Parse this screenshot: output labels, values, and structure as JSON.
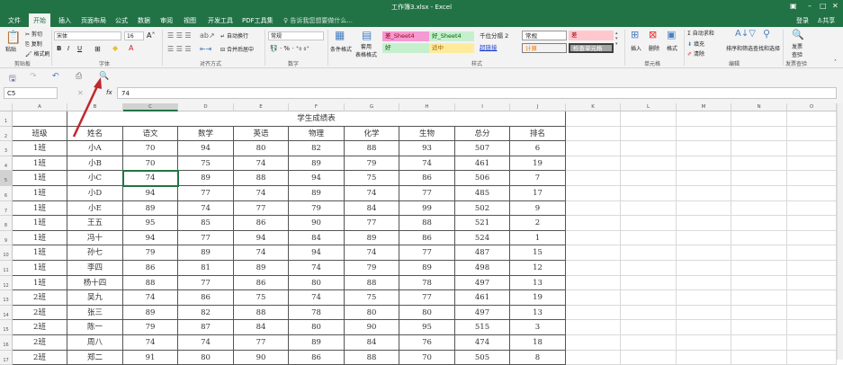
{
  "window": {
    "title": "工作簿3.xlsx - Excel",
    "login": "登录",
    "share": "共享"
  },
  "tabs": [
    "文件",
    "开始",
    "插入",
    "页面布局",
    "公式",
    "数据",
    "审阅",
    "视图",
    "开发工具",
    "PDF工具集"
  ],
  "tell_me": "告诉我您想要做什么...",
  "ribbon": {
    "clipboard": {
      "paste": "粘贴",
      "cut": "剪切",
      "copy": "复制",
      "format_painter": "格式刷",
      "group": "剪贴板"
    },
    "font": {
      "name": "宋体",
      "size": "16",
      "group": "字体",
      "bold": "B",
      "italic": "I",
      "underline": "U"
    },
    "alignment": {
      "wrap": "自动换行",
      "merge": "合并后居中",
      "group": "对齐方式"
    },
    "number": {
      "format": "常规",
      "group": "数字",
      "percent": "%"
    },
    "styles": {
      "conditional": "条件格式",
      "table": "套用\n表格格式",
      "items": [
        "差_Sheet4",
        "好_Sheet4",
        "千位分隔 2",
        "常规",
        "差",
        "好",
        "适中",
        "超链接",
        "计算",
        "检查单元格"
      ],
      "group": "样式"
    },
    "cells": {
      "insert": "插入",
      "delete": "删除",
      "format": "格式",
      "group": "单元格"
    },
    "editing": {
      "autosum": "自动求和",
      "fill": "填充",
      "clear": "清除",
      "sort": "排序和筛选",
      "find": "查找和选择",
      "group": "编辑"
    },
    "invoice": {
      "label": "发票\n查验",
      "group": "发票查验"
    }
  },
  "formula_bar": {
    "name_box": "C5",
    "fx": "fx",
    "value": "74"
  },
  "columns": [
    "A",
    "B",
    "C",
    "D",
    "E",
    "F",
    "G",
    "H",
    "I",
    "J",
    "K",
    "L",
    "M",
    "N",
    "O"
  ],
  "sheet": {
    "title": "学生成绩表",
    "headers": [
      "班级",
      "姓名",
      "语文",
      "数学",
      "英语",
      "物理",
      "化学",
      "生物",
      "总分",
      "排名"
    ],
    "rows": [
      [
        "1班",
        "小A",
        "70",
        "94",
        "80",
        "82",
        "88",
        "93",
        "507",
        "6"
      ],
      [
        "1班",
        "小B",
        "70",
        "75",
        "74",
        "89",
        "79",
        "74",
        "461",
        "19"
      ],
      [
        "1班",
        "小C",
        "74",
        "89",
        "88",
        "94",
        "75",
        "86",
        "506",
        "7"
      ],
      [
        "1班",
        "小D",
        "94",
        "77",
        "74",
        "89",
        "74",
        "77",
        "485",
        "17"
      ],
      [
        "1班",
        "小E",
        "89",
        "74",
        "77",
        "79",
        "84",
        "99",
        "502",
        "9"
      ],
      [
        "1班",
        "王五",
        "95",
        "85",
        "86",
        "90",
        "77",
        "88",
        "521",
        "2"
      ],
      [
        "1班",
        "冯十",
        "94",
        "77",
        "94",
        "84",
        "89",
        "86",
        "524",
        "1"
      ],
      [
        "1班",
        "孙七",
        "79",
        "89",
        "74",
        "94",
        "74",
        "77",
        "487",
        "15"
      ],
      [
        "1班",
        "李四",
        "86",
        "81",
        "89",
        "74",
        "79",
        "89",
        "498",
        "12"
      ],
      [
        "1班",
        "杨十四",
        "88",
        "77",
        "86",
        "80",
        "88",
        "78",
        "497",
        "13"
      ],
      [
        "2班",
        "吴九",
        "74",
        "86",
        "75",
        "74",
        "75",
        "77",
        "461",
        "19"
      ],
      [
        "2班",
        "张三",
        "89",
        "82",
        "88",
        "78",
        "80",
        "80",
        "497",
        "13"
      ],
      [
        "2班",
        "陈一",
        "79",
        "87",
        "84",
        "80",
        "90",
        "95",
        "515",
        "3"
      ],
      [
        "2班",
        "周八",
        "74",
        "74",
        "77",
        "89",
        "84",
        "76",
        "474",
        "18"
      ],
      [
        "2班",
        "郑二",
        "91",
        "80",
        "90",
        "86",
        "88",
        "70",
        "505",
        "8"
      ]
    ]
  },
  "colors": {
    "excel_green": "#217346",
    "annotation_arrow": "#c0282d"
  }
}
